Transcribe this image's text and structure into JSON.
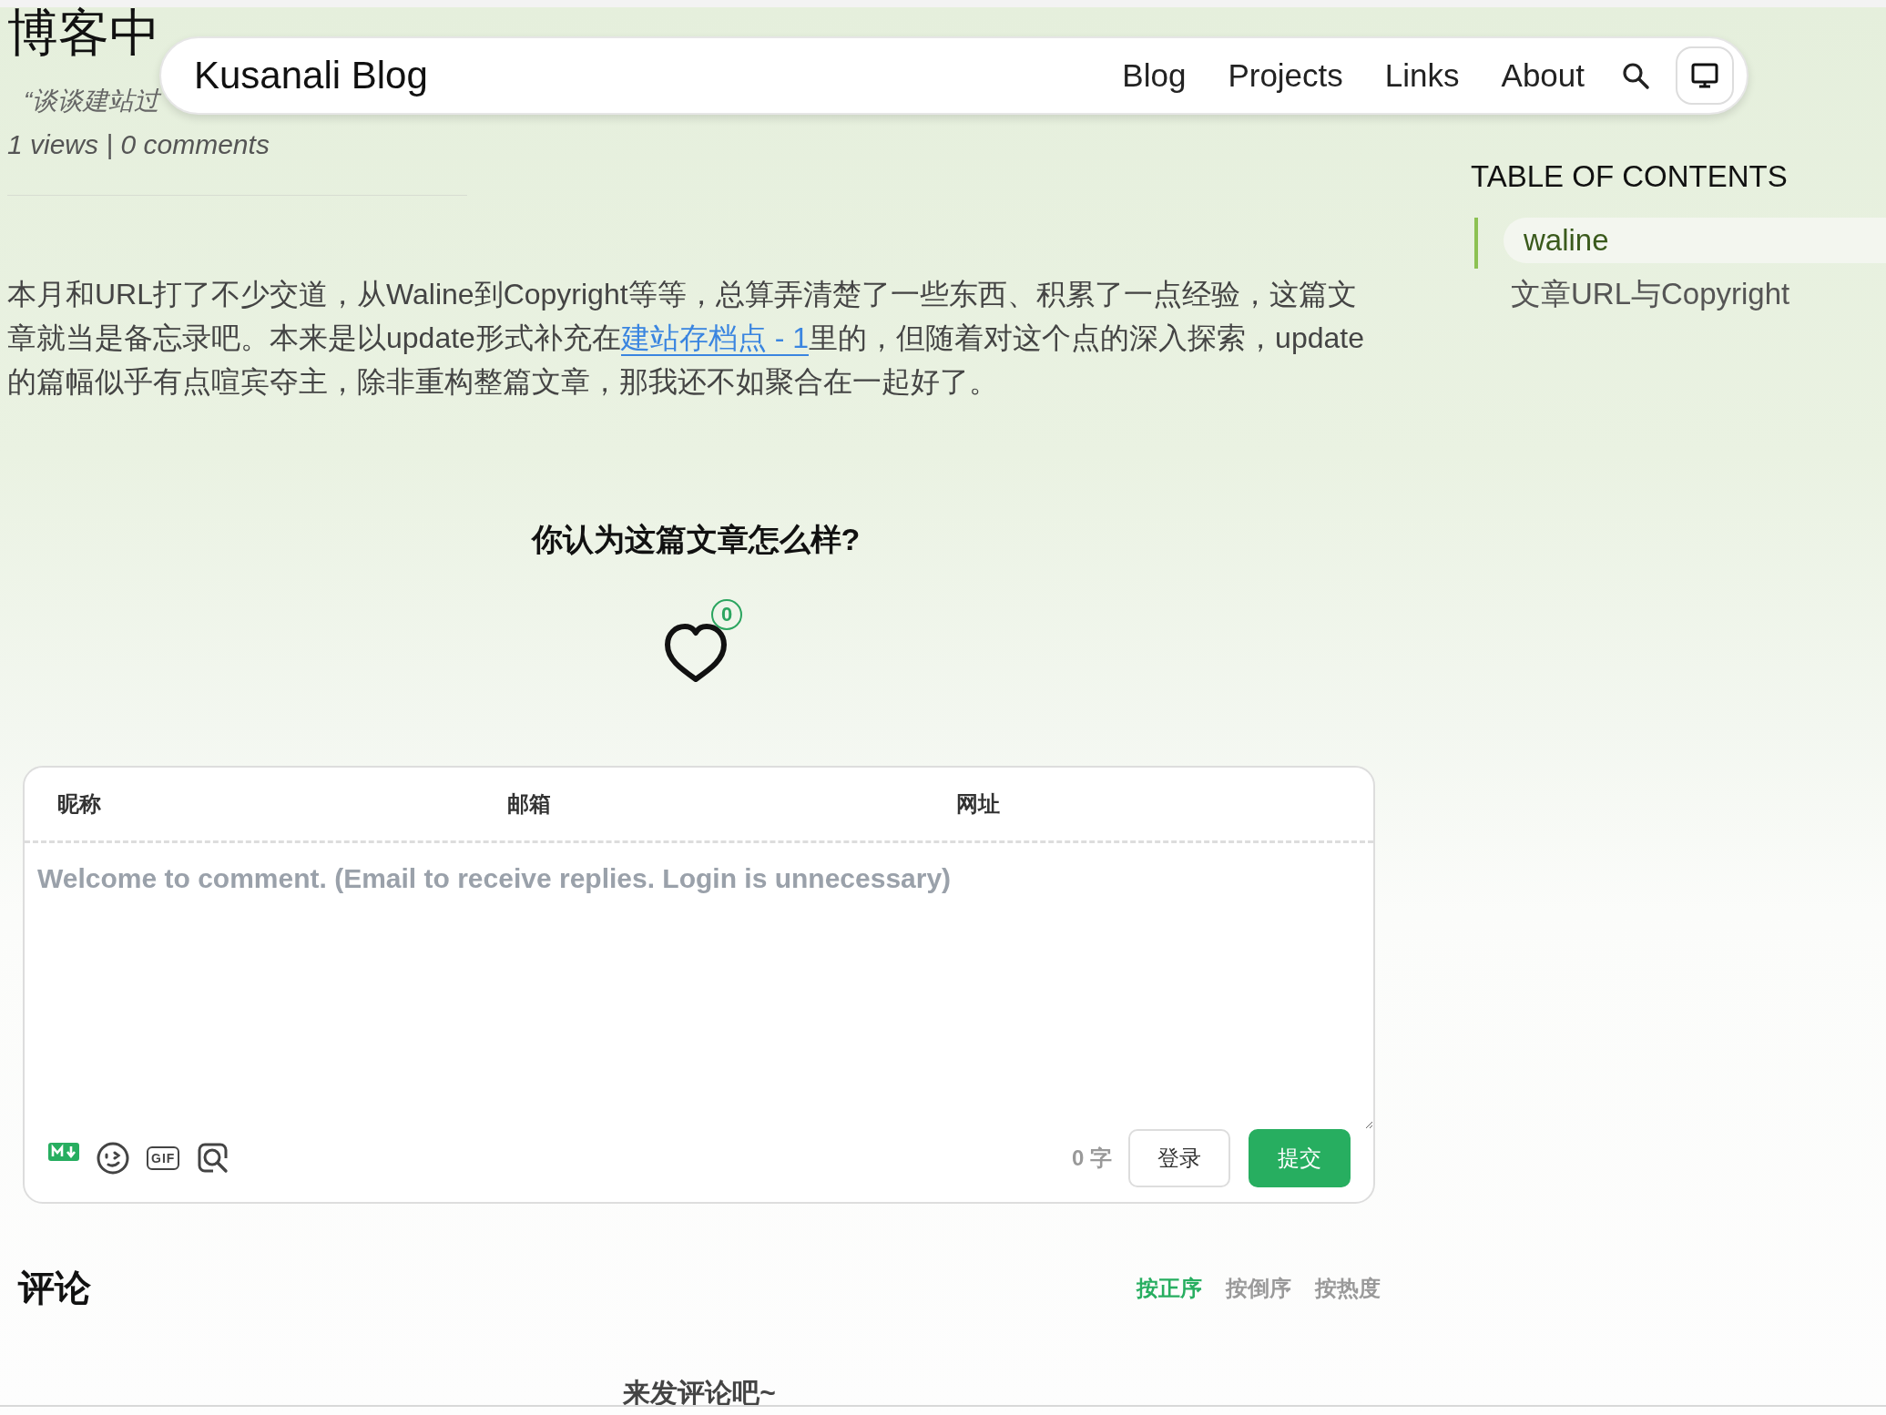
{
  "nav": {
    "brand": "Kusanali Blog",
    "links": [
      "Blog",
      "Projects",
      "Links",
      "About"
    ]
  },
  "post": {
    "title": "博客中",
    "subtitle": "“谈谈建站过",
    "meta": "1 views | 0 comments",
    "body": [
      {
        "kind": "text",
        "text": "本月和URL打了不少交道，从Waline到Copyright等等，总算弄清楚了一些东西、积累了一点经验，这篇文章就当是备忘录吧。本来是以update形式补充在"
      },
      {
        "kind": "link",
        "text": "建站存档点 - 1"
      },
      {
        "kind": "text",
        "text": "里的，但随着对这个点的深入探索，update的篇幅似乎有点喧宾夺主，除非重构整篇文章，那我还不如聚合在一起好了。"
      }
    ]
  },
  "toc": {
    "title": "TABLE OF CONTENTS",
    "items": [
      {
        "label": "waline",
        "selected": true
      },
      {
        "label": "文章URL与Copyright",
        "selected": false
      }
    ]
  },
  "reaction": {
    "question": "你认为这篇文章怎么样?",
    "count": "0"
  },
  "comment_form": {
    "fields": [
      {
        "label": "昵称"
      },
      {
        "label": "邮箱"
      },
      {
        "label": "网址"
      }
    ],
    "placeholder": "Welcome to comment. (Email to receive replies. Login is unnecessary)",
    "gif_label": "GIF",
    "word_count": "0 字",
    "buttons": [
      {
        "label": "登录",
        "kind": "secondary"
      },
      {
        "label": "提交",
        "kind": "primary"
      }
    ]
  },
  "comments": {
    "title": "评论",
    "sort": [
      {
        "label": "按正序",
        "selected": true
      },
      {
        "label": "按倒序",
        "selected": false
      },
      {
        "label": "按热度",
        "selected": false
      }
    ],
    "empty": "来发评论吧~"
  }
}
